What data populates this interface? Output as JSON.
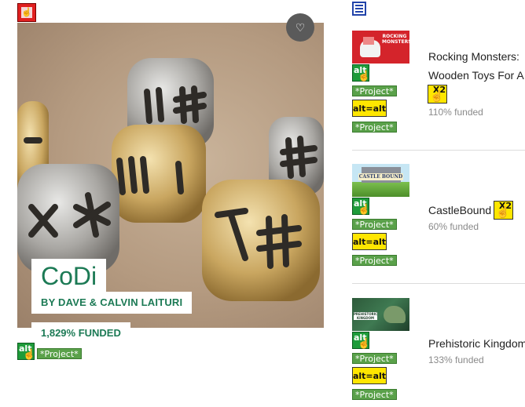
{
  "featured": {
    "title": "CoDi",
    "byline": "BY DAVE & CALVIN LAITURI",
    "funded": "1,829% FUNDED",
    "project_tag": "*Project*",
    "alt_badge": "alt"
  },
  "list": {
    "items": [
      {
        "title_line1": "Rocking Monsters:",
        "title_line2": "Wooden Toys For A",
        "funded": "110% funded",
        "thumb_text": "ROCKING MONSTERS"
      },
      {
        "title_line1": "CastleBound",
        "funded": "60% funded",
        "thumb_text": "CASTLE BOUND"
      },
      {
        "title_line1": "Prehistoric Kingdom",
        "funded": "133% funded",
        "thumb_text": "PREHISTORIC KINGDOM"
      }
    ]
  },
  "badges": {
    "alt": "alt",
    "project": "*Project*",
    "alt_eq": "alt=alt",
    "x2": "X2"
  },
  "colors": {
    "accent_green": "#1c7a55",
    "badge_green": "#1e9b3a",
    "project_green": "#5aa14a",
    "badge_yellow": "#ffe600"
  }
}
